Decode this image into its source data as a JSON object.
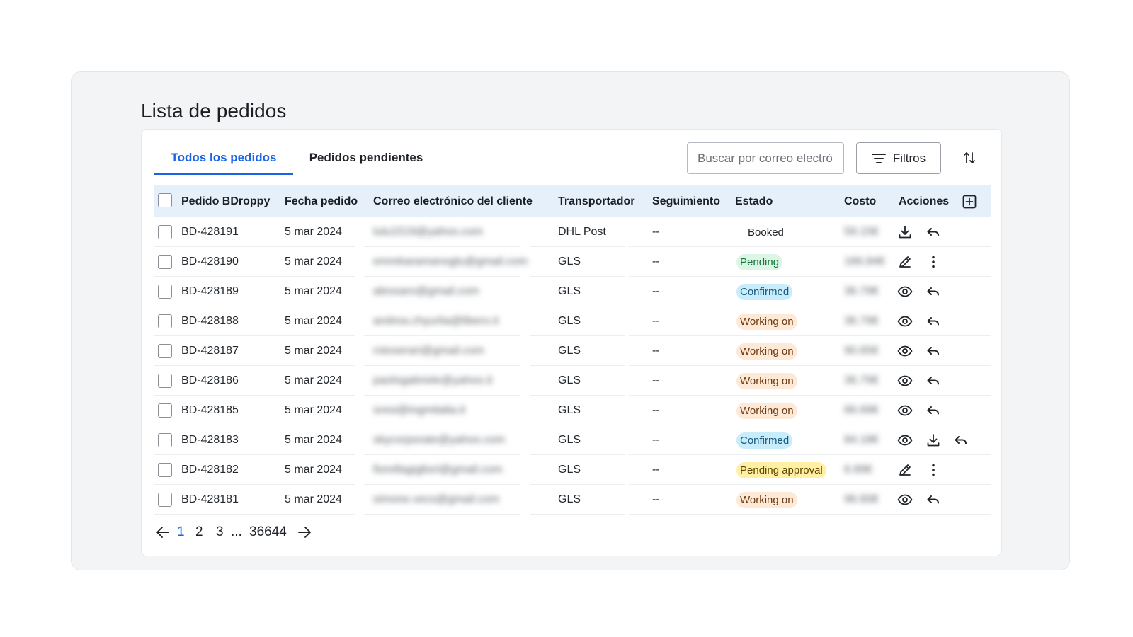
{
  "page": {
    "title": "Lista de pedidos"
  },
  "tabs": [
    {
      "label": "Todos los pedidos",
      "active": true
    },
    {
      "label": "Pedidos pendientes",
      "active": false
    }
  ],
  "toolbar": {
    "search_placeholder": "Buscar por correo electrónico",
    "filters_label": "Filtros"
  },
  "table": {
    "columns": [
      "Pedido BDroppy",
      "Fecha pedido",
      "Correo electrónico del cliente",
      "Transportador",
      "Seguimiento",
      "Estado",
      "Costo",
      "Acciones"
    ],
    "rows": [
      {
        "order": "BD-428191",
        "date": "5 mar 2024",
        "email": "lulu1519@yahoo.com",
        "carrier": "DHL Post",
        "tracking": "--",
        "status": "Booked",
        "status_type": "plain",
        "cost": "59.15€",
        "actions": [
          "download-icon",
          "undo-icon"
        ]
      },
      {
        "order": "BD-428190",
        "date": "5 mar 2024",
        "email": "emrekaramanoglu@gmail.com",
        "carrier": "GLS",
        "tracking": "--",
        "status": "Pending",
        "status_type": "pending",
        "cost": "166.84€",
        "actions": [
          "edit-icon",
          "more-vertical-icon"
        ]
      },
      {
        "order": "BD-428189",
        "date": "5 mar 2024",
        "email": "alessaro@gmail.com",
        "carrier": "GLS",
        "tracking": "--",
        "status": "Confirmed",
        "status_type": "confirmed",
        "cost": "36.79€",
        "actions": [
          "eye-icon",
          "undo-icon"
        ]
      },
      {
        "order": "BD-428188",
        "date": "5 mar 2024",
        "email": "andrea.chyurlia@libero.it",
        "carrier": "GLS",
        "tracking": "--",
        "status": "Working on",
        "status_type": "working",
        "cost": "36.79€",
        "actions": [
          "eye-icon",
          "undo-icon"
        ]
      },
      {
        "order": "BD-428187",
        "date": "5 mar 2024",
        "email": "rotoserari@gmail.com",
        "carrier": "GLS",
        "tracking": "--",
        "status": "Working on",
        "status_type": "working",
        "cost": "90.65€",
        "actions": [
          "eye-icon",
          "undo-icon"
        ]
      },
      {
        "order": "BD-428186",
        "date": "5 mar 2024",
        "email": "paologabriele@yahoo.it",
        "carrier": "GLS",
        "tracking": "--",
        "status": "Working on",
        "status_type": "working",
        "cost": "36.79€",
        "actions": [
          "eye-icon",
          "undo-icon"
        ]
      },
      {
        "order": "BD-428185",
        "date": "5 mar 2024",
        "email": "sresi@ingmitalia.it",
        "carrier": "GLS",
        "tracking": "--",
        "status": "Working on",
        "status_type": "working",
        "cost": "66.69€",
        "actions": [
          "eye-icon",
          "undo-icon"
        ]
      },
      {
        "order": "BD-428183",
        "date": "5 mar 2024",
        "email": "skycorporate@yahoo.com",
        "carrier": "GLS",
        "tracking": "--",
        "status": "Confirmed",
        "status_type": "confirmed",
        "cost": "84.18€",
        "actions": [
          "eye-icon",
          "download-icon",
          "undo-icon"
        ]
      },
      {
        "order": "BD-428182",
        "date": "5 mar 2024",
        "email": "fiorellagigliori@gmail.com",
        "carrier": "GLS",
        "tracking": "--",
        "status": "Pending approval",
        "status_type": "approval",
        "cost": "6.89€",
        "actions": [
          "edit-icon",
          "more-vertical-icon"
        ]
      },
      {
        "order": "BD-428181",
        "date": "5 mar 2024",
        "email": "simone.vecs@gmail.com",
        "carrier": "GLS",
        "tracking": "--",
        "status": "Working on",
        "status_type": "working",
        "cost": "96.60€",
        "actions": [
          "eye-icon",
          "undo-icon"
        ]
      }
    ]
  },
  "pagination": {
    "pages": [
      "1",
      "2",
      "3"
    ],
    "ellipsis": "...",
    "last": "36644",
    "current": "1"
  },
  "colors": {
    "accent": "#1a63e6",
    "header_bg": "#e6f0fb"
  },
  "icons": {
    "filter": "filter-lines-icon",
    "sort": "sort-arrows-icon",
    "add_column": "plus-square-icon",
    "prev": "arrow-left-icon",
    "next": "arrow-right-icon"
  }
}
